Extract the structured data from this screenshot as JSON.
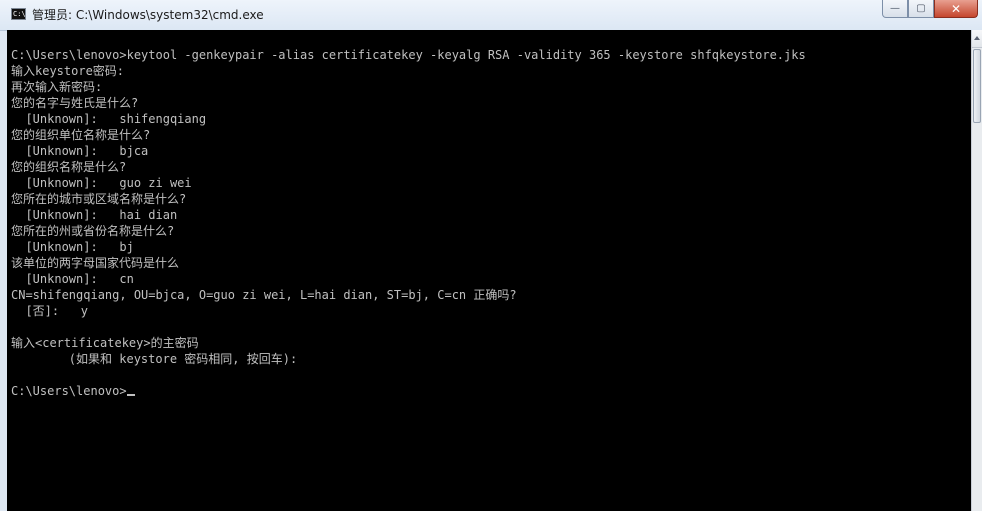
{
  "window": {
    "title": "管理员: C:\\Windows\\system32\\cmd.exe",
    "icon": "cmd-icon",
    "controls": {
      "minimize": "—",
      "maximize": "▢",
      "close": "✕"
    }
  },
  "console": {
    "lines": [
      "C:\\Users\\lenovo>keytool -genkeypair -alias certificatekey -keyalg RSA -validity 365 -keystore shfqkeystore.jks",
      "输入keystore密码:",
      "再次输入新密码:",
      "您的名字与姓氏是什么?",
      "  [Unknown]:   shifengqiang",
      "您的组织单位名称是什么?",
      "  [Unknown]:   bjca",
      "您的组织名称是什么?",
      "  [Unknown]:   guo zi wei",
      "您所在的城市或区域名称是什么?",
      "  [Unknown]:   hai dian",
      "您所在的州或省份名称是什么?",
      "  [Unknown]:   bj",
      "该单位的两字母国家代码是什么",
      "  [Unknown]:   cn",
      "CN=shifengqiang, OU=bjca, O=guo zi wei, L=hai dian, ST=bj, C=cn 正确吗?",
      "  [否]:   y",
      "",
      "输入<certificatekey>的主密码",
      "        (如果和 keystore 密码相同, 按回车):",
      "",
      "C:\\Users\\lenovo>"
    ]
  },
  "colors": {
    "console_bg": "#000000",
    "console_text": "#c0c0c0"
  }
}
